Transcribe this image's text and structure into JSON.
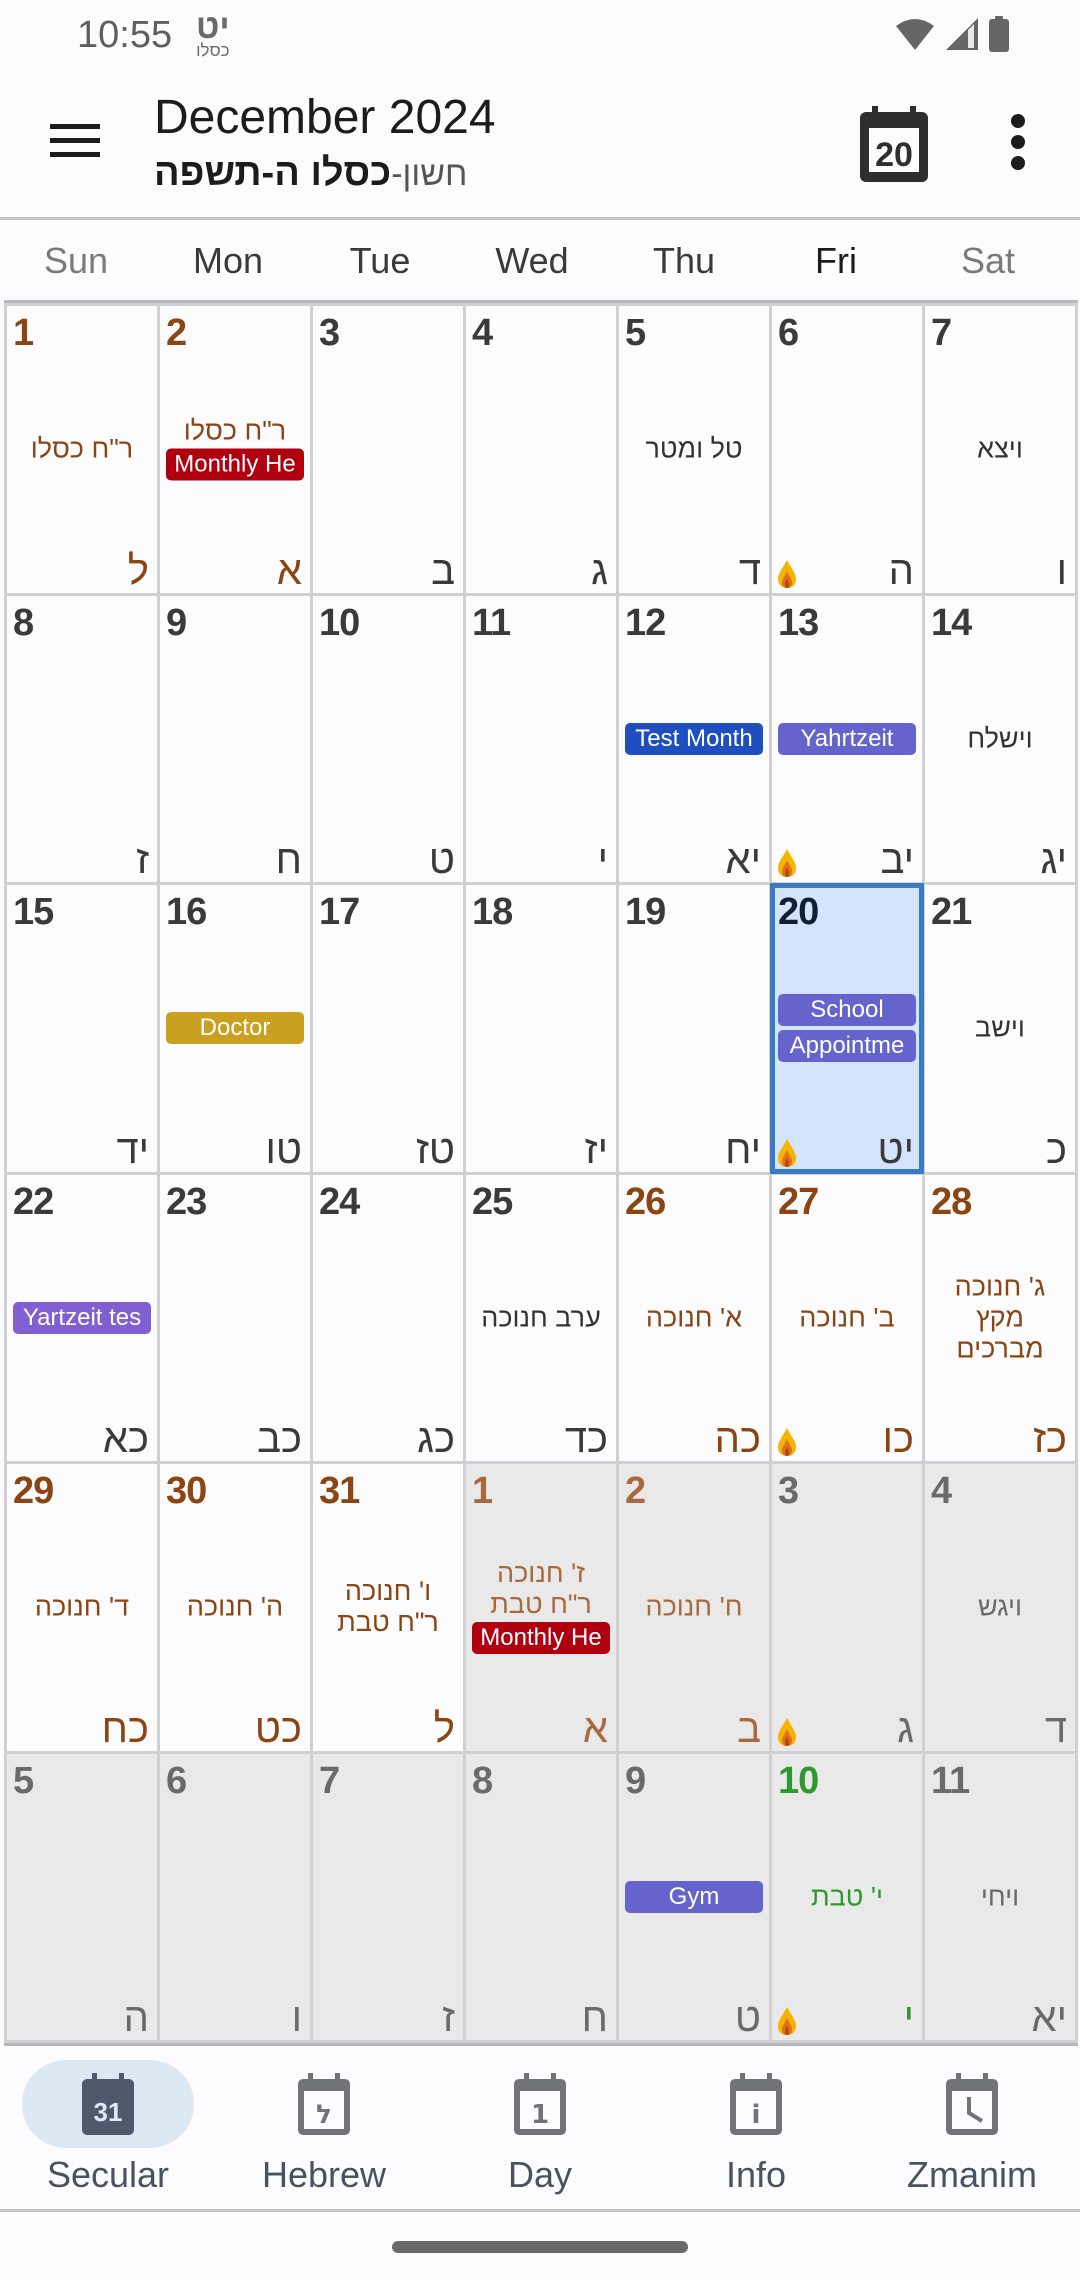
{
  "status_bar": {
    "time": "10:55",
    "hebrew_day": "יט",
    "hebrew_month": "כסלו",
    "icons": [
      "wifi-icon",
      "signal-icon",
      "battery-icon"
    ]
  },
  "app_bar": {
    "title": "December 2024",
    "subtitle_prefix": "חשון-",
    "subtitle_month": "כסלו",
    "subtitle_year": " ה-תשפה",
    "today_icon_number": "20",
    "menu_icon": "hamburger-icon",
    "more_icon": "more-vert-icon"
  },
  "colors": {
    "holiday": "#8b4513",
    "fast": "#2e9a2e",
    "selected_bg": "#d4e4fb",
    "selected_border": "#3a7ac0",
    "event_red": "#b00010",
    "event_blue": "#1f4fbf",
    "event_indigo": "#6464cc",
    "event_gold": "#c9a020",
    "event_purple": "#8060d0"
  },
  "weekdays": [
    "Sun",
    "Mon",
    "Tue",
    "Wed",
    "Thu",
    "Fri",
    "Sat"
  ],
  "days": [
    {
      "num": "1",
      "heb": "ל",
      "type": "holiday",
      "notes": [
        "ר\"ח כסלו"
      ],
      "events": []
    },
    {
      "num": "2",
      "heb": "א",
      "type": "holiday",
      "notes": [
        "ר\"ח כסלו"
      ],
      "events": [
        {
          "label": "Monthly He",
          "color": "#b00010"
        }
      ]
    },
    {
      "num": "3",
      "heb": "ב",
      "notes": [],
      "events": []
    },
    {
      "num": "4",
      "heb": "ג",
      "notes": [],
      "events": []
    },
    {
      "num": "5",
      "heb": "ד",
      "notes": [
        "טל ומטר"
      ],
      "events": []
    },
    {
      "num": "6",
      "heb": "ה",
      "notes": [],
      "events": [],
      "candle": true
    },
    {
      "num": "7",
      "heb": "ו",
      "notes": [
        "ויצא"
      ],
      "events": []
    },
    {
      "num": "8",
      "heb": "ז",
      "notes": [],
      "events": []
    },
    {
      "num": "9",
      "heb": "ח",
      "notes": [],
      "events": []
    },
    {
      "num": "10",
      "heb": "ט",
      "notes": [],
      "events": []
    },
    {
      "num": "11",
      "heb": "י",
      "notes": [],
      "events": []
    },
    {
      "num": "12",
      "heb": "יא",
      "notes": [],
      "events": [
        {
          "label": "Test Month",
          "color": "#1f4fbf"
        }
      ]
    },
    {
      "num": "13",
      "heb": "יב",
      "notes": [],
      "events": [
        {
          "label": "Yahrtzeit",
          "color": "#6464cc"
        }
      ],
      "candle": true
    },
    {
      "num": "14",
      "heb": "יג",
      "notes": [
        "וישלח"
      ],
      "events": []
    },
    {
      "num": "15",
      "heb": "יד",
      "notes": [],
      "events": []
    },
    {
      "num": "16",
      "heb": "טו",
      "notes": [],
      "events": [
        {
          "label": "Doctor",
          "color": "#c9a020"
        }
      ]
    },
    {
      "num": "17",
      "heb": "טז",
      "notes": [],
      "events": []
    },
    {
      "num": "18",
      "heb": "יז",
      "notes": [],
      "events": []
    },
    {
      "num": "19",
      "heb": "יח",
      "notes": [],
      "events": []
    },
    {
      "num": "20",
      "heb": "יט",
      "notes": [],
      "events": [
        {
          "label": "School",
          "color": "#6464cc"
        },
        {
          "label": "Appointme",
          "color": "#6464cc"
        }
      ],
      "candle": true,
      "selected": true
    },
    {
      "num": "21",
      "heb": "כ",
      "notes": [
        "וישב"
      ],
      "events": []
    },
    {
      "num": "22",
      "heb": "כא",
      "notes": [],
      "events": [
        {
          "label": "Yartzeit tes",
          "color": "#8060d0"
        }
      ]
    },
    {
      "num": "23",
      "heb": "כב",
      "notes": [],
      "events": []
    },
    {
      "num": "24",
      "heb": "כג",
      "notes": [],
      "events": []
    },
    {
      "num": "25",
      "heb": "כד",
      "notes": [
        "ערב חנוכה"
      ],
      "events": []
    },
    {
      "num": "26",
      "heb": "כה",
      "type": "holiday",
      "notes": [
        "א' חנוכה"
      ],
      "events": []
    },
    {
      "num": "27",
      "heb": "כו",
      "type": "holiday",
      "notes": [
        "ב' חנוכה"
      ],
      "events": [],
      "candle": true
    },
    {
      "num": "28",
      "heb": "כז",
      "type": "holiday",
      "notes": [
        "ג' חנוכה",
        "מקץ",
        "מברכים"
      ],
      "events": []
    },
    {
      "num": "29",
      "heb": "כח",
      "type": "holiday",
      "notes": [
        "ד' חנוכה"
      ],
      "events": []
    },
    {
      "num": "30",
      "heb": "כט",
      "type": "holiday",
      "notes": [
        "ה' חנוכה"
      ],
      "events": []
    },
    {
      "num": "31",
      "heb": "ל",
      "type": "holiday",
      "notes": [
        "ו' חנוכה",
        "ר\"ח טבת"
      ],
      "events": []
    },
    {
      "num": "1",
      "heb": "א",
      "type": "holiday",
      "other": true,
      "notes": [
        "ז' חנוכה",
        "ר\"ח טבת"
      ],
      "events": [
        {
          "label": "Monthly He",
          "color": "#b00010"
        }
      ]
    },
    {
      "num": "2",
      "heb": "ב",
      "type": "holiday",
      "other": true,
      "notes": [
        "ח' חנוכה"
      ],
      "events": []
    },
    {
      "num": "3",
      "heb": "ג",
      "other": true,
      "notes": [],
      "events": [],
      "candle": true
    },
    {
      "num": "4",
      "heb": "ד",
      "other": true,
      "notes": [
        "ויגש"
      ],
      "events": []
    },
    {
      "num": "5",
      "heb": "ה",
      "other": true,
      "notes": [],
      "events": []
    },
    {
      "num": "6",
      "heb": "ו",
      "other": true,
      "notes": [],
      "events": []
    },
    {
      "num": "7",
      "heb": "ז",
      "other": true,
      "notes": [],
      "events": []
    },
    {
      "num": "8",
      "heb": "ח",
      "other": true,
      "notes": [],
      "events": []
    },
    {
      "num": "9",
      "heb": "ט",
      "other": true,
      "notes": [],
      "events": [
        {
          "label": "Gym",
          "color": "#6464cc"
        }
      ]
    },
    {
      "num": "10",
      "heb": "י",
      "type": "fast",
      "other": true,
      "notes": [
        "י' טבת"
      ],
      "events": [],
      "candle": true
    },
    {
      "num": "11",
      "heb": "יא",
      "other": true,
      "notes": [
        "ויחי"
      ],
      "events": []
    }
  ],
  "bottom_nav": [
    {
      "label": "Secular",
      "icon": "calendar-31-icon",
      "icon_text": "31",
      "active": true
    },
    {
      "label": "Hebrew",
      "icon": "calendar-hebrew-icon",
      "icon_text": "ל",
      "active": false
    },
    {
      "label": "Day",
      "icon": "calendar-day-icon",
      "icon_text": "1",
      "active": false
    },
    {
      "label": "Info",
      "icon": "calendar-info-icon",
      "icon_text": "i",
      "active": false
    },
    {
      "label": "Zmanim",
      "icon": "calendar-clock-icon",
      "icon_text": "",
      "active": false
    }
  ]
}
